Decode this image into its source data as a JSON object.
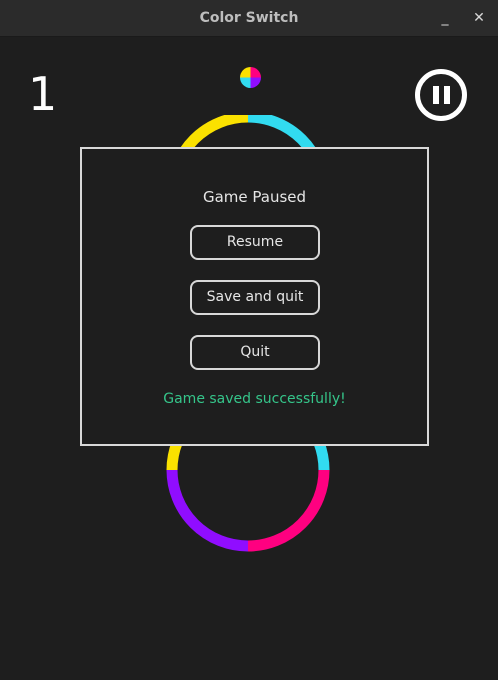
{
  "window": {
    "title": "Color Switch",
    "minimize_glyph": "_",
    "close_glyph": "✕"
  },
  "game": {
    "score": "1",
    "pause_icon": "pause-icon",
    "colors": {
      "yellow": "#fae100",
      "cyan": "#32dbf0",
      "magenta": "#ff0080",
      "purple": "#900dff",
      "background": "#1e1e1e"
    }
  },
  "pause_menu": {
    "title": "Game Paused",
    "resume_label": "Resume",
    "save_quit_label": "Save and quit",
    "quit_label": "Quit",
    "status_message": "Game saved successfully!",
    "status_color": "#35c58a"
  }
}
